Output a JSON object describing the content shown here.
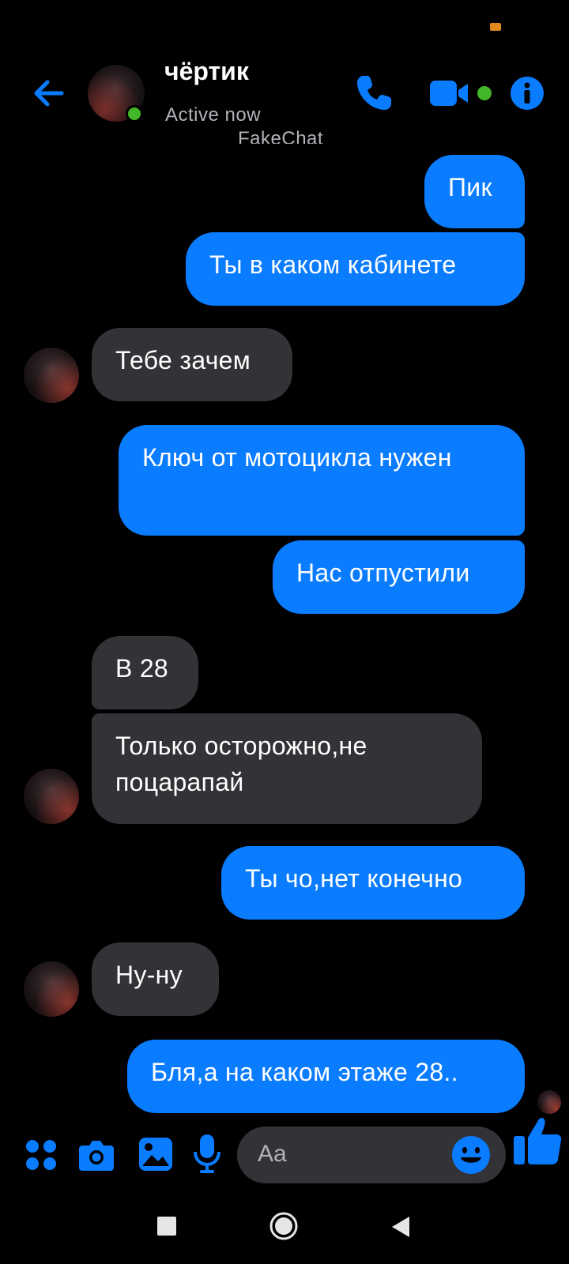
{
  "header": {
    "contact_name": "чёртик",
    "status": "Active now",
    "watermark": "FakeChat"
  },
  "messages": [
    {
      "direction": "outgoing",
      "text": "Пик"
    },
    {
      "direction": "outgoing",
      "text": "Ты в каком кабинете"
    },
    {
      "direction": "incoming",
      "text": "Тебе зачем"
    },
    {
      "direction": "outgoing",
      "text": "Ключ от мотоцикла нужен"
    },
    {
      "direction": "outgoing",
      "text": "Нас отпустили"
    },
    {
      "direction": "incoming",
      "text": "В 28"
    },
    {
      "direction": "incoming",
      "text": "Только осторожно,не поцарапай"
    },
    {
      "direction": "outgoing",
      "text": "Ты чо,нет конечно"
    },
    {
      "direction": "incoming",
      "text": "Ну-ну"
    },
    {
      "direction": "outgoing",
      "text": "Бля,а на каком этаже 28.."
    }
  ],
  "composer": {
    "placeholder": "Aa"
  },
  "icons": {
    "back": "arrow-left-icon",
    "call": "phone-icon",
    "video": "video-camera-icon",
    "info": "info-icon",
    "menu": "four-dots-icon",
    "camera": "camera-icon",
    "gallery": "image-icon",
    "voice": "microphone-icon",
    "emoji": "smiley-icon",
    "like": "thumbs-up-icon"
  },
  "colors": {
    "accent": "#0a7cff",
    "incoming_bubble": "#333236",
    "online": "#42b72a",
    "background": "#000000"
  }
}
